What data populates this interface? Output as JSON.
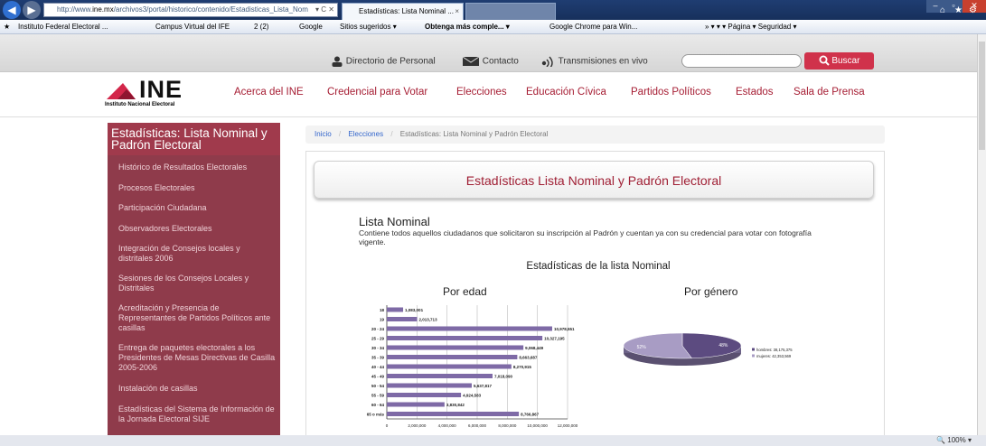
{
  "browser": {
    "url": "http://www.ine.mx/archivos3/portal/historico/contenido/Estadisticas_Lista_Nom",
    "url_prefix": "http://www.",
    "url_domain": "ine.mx",
    "url_rest": "/archivos3/portal/historico/contenido/Estadisticas_Lista_Nom",
    "addr_controls": "▾ C ✕",
    "active_tab": "Estadísticas: Lista Nominal ...",
    "tab_close": "×",
    "favorites": [
      "Instituto Federal Electoral ...",
      "Campus Virtual del IFE",
      "2 (2)",
      "Google",
      "Sitios sugeridos ▾",
      "Obtenga más comple... ▾",
      "Google Chrome para Win..."
    ],
    "right_tools": "»    ▾  ▾  ▾   Página ▾  Seguridad ▾",
    "zoom": "100%"
  },
  "utility": {
    "directorio": "Directorio de Personal",
    "contacto": "Contacto",
    "transmisiones": "Transmisiones en vivo",
    "search_button": "Buscar",
    "search_placeholder": ""
  },
  "logo": {
    "name": "INE",
    "sub": "Instituto Nacional Electoral"
  },
  "nav": [
    "Acerca del INE",
    "Credencial para Votar",
    "Elecciones",
    "Educación Cívica",
    "Partidos Políticos",
    "Estados",
    "Sala de Prensa"
  ],
  "sidebar": {
    "title": "Estadísticas: Lista Nominal y Padrón Electoral",
    "items": [
      "Histórico de Resultados Electorales",
      "Procesos Electorales",
      "Participación Ciudadana",
      "Observadores Electorales",
      "Integración de Consejos locales y distritales 2006",
      "Sesiones de los Consejos Locales y Distritales",
      "Acreditación y Presencia de Representantes de Partidos Políticos ante casillas",
      "Entrega de paquetes electorales a los Presidentes de Mesas Directivas de Casilla 2005-2006",
      "Instalación de casillas",
      "Estadísticas del Sistema de Información de la Jornada Electoral SIJE"
    ]
  },
  "breadcrumb": {
    "home": "Inicio",
    "sep": "/",
    "section": "Elecciones",
    "current": "Estadísticas: Lista Nominal y Padrón Electoral"
  },
  "main": {
    "page_title": "Estadísticas Lista Nominal y Padrón Electoral",
    "section_title": "Lista Nominal",
    "section_desc": "Contiene todos aquellos ciudadanos que solicitaron su inscripción al Padrón y cuentan ya con su credencial para votar con fotografía vigente.",
    "stats_title": "Estadísticas de la lista Nominal",
    "age_title": "Por edad",
    "gender_title": "Por género"
  },
  "chart_data": [
    {
      "type": "bar",
      "orientation": "horizontal",
      "title": "",
      "categories": [
        "18",
        "19",
        "20 - 24",
        "25 - 29",
        "30 - 34",
        "35 - 39",
        "40 - 44",
        "45 - 49",
        "50 - 54",
        "55 - 59",
        "60 - 64",
        "65 o más"
      ],
      "values": [
        1083001,
        2013713,
        10978551,
        10327195,
        9068449,
        8663687,
        8270915,
        7018090,
        5637817,
        4924583,
        3830842,
        8766867
      ],
      "value_labels": [
        "1,083,001",
        "2,013,713",
        "10,978,551",
        "10,327,195",
        "9,068,449",
        "8,663,687",
        "8,270,915",
        "7,018,090",
        "5,637,817",
        "4,924,583",
        "3,830,842",
        "8,766,867"
      ],
      "xticks": [
        "0",
        "2,000,000",
        "4,000,000",
        "6,000,000",
        "8,000,000",
        "10,000,000",
        "12,000,000"
      ],
      "xlim": [
        0,
        12000000
      ],
      "grid": true,
      "color": "#7e6aa6"
    },
    {
      "type": "pie",
      "title": "",
      "slices": [
        {
          "label": "hombres",
          "value": 38175375,
          "percent": "48%",
          "legend": "hombres: 38,175,375",
          "color": "#5c4b80"
        },
        {
          "label": "mujeres",
          "value": 42353569,
          "percent": "52%",
          "legend": "mujeres: 42,353,569",
          "color": "#a89cc4"
        }
      ],
      "legend_position": "right"
    }
  ],
  "colors": {
    "brand": "#a61d33",
    "sidebar": "#8f3b4b",
    "search_button": "#d0324b"
  }
}
